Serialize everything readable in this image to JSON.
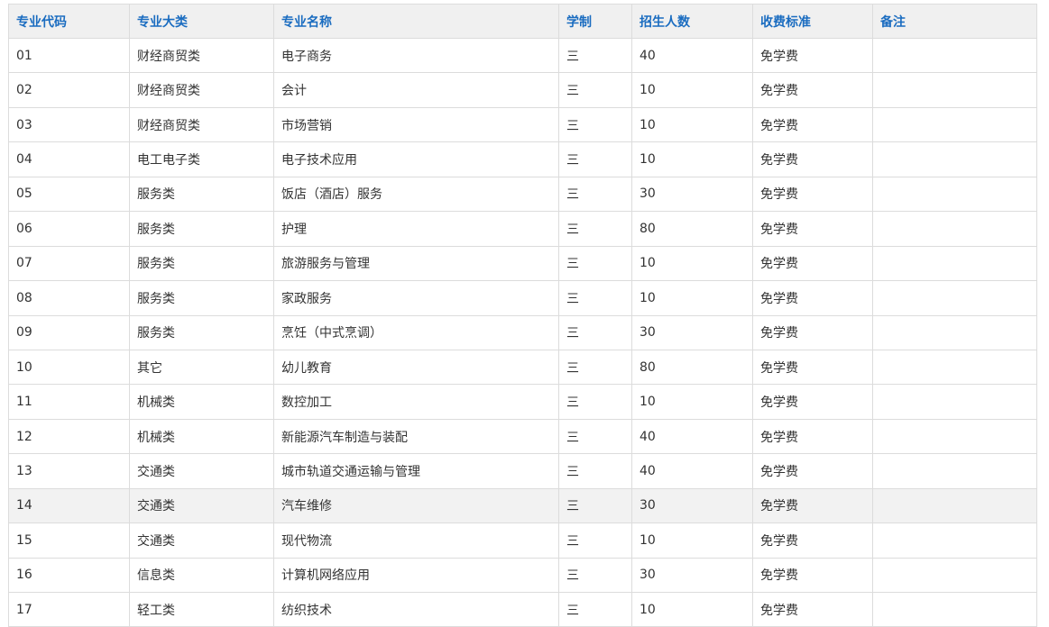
{
  "table": {
    "headers": [
      "专业代码",
      "专业大类",
      "专业名称",
      "学制",
      "招生人数",
      "收费标准",
      "备注"
    ],
    "rows": [
      [
        "01",
        "财经商贸类",
        "电子商务",
        "三",
        "40",
        "免学费",
        ""
      ],
      [
        "02",
        "财经商贸类",
        "会计",
        "三",
        "10",
        "免学费",
        ""
      ],
      [
        "03",
        "财经商贸类",
        "市场营销",
        "三",
        "10",
        "免学费",
        ""
      ],
      [
        "04",
        "电工电子类",
        "电子技术应用",
        "三",
        "10",
        "免学费",
        ""
      ],
      [
        "05",
        "服务类",
        "饭店（酒店）服务",
        "三",
        "30",
        "免学费",
        ""
      ],
      [
        "06",
        "服务类",
        "护理",
        "三",
        "80",
        "免学费",
        ""
      ],
      [
        "07",
        "服务类",
        "旅游服务与管理",
        "三",
        "10",
        "免学费",
        ""
      ],
      [
        "08",
        "服务类",
        "家政服务",
        "三",
        "10",
        "免学费",
        ""
      ],
      [
        "09",
        "服务类",
        "烹饪（中式烹调）",
        "三",
        "30",
        "免学费",
        ""
      ],
      [
        "10",
        "其它",
        "幼儿教育",
        "三",
        "80",
        "免学费",
        ""
      ],
      [
        "11",
        "机械类",
        "数控加工",
        "三",
        "10",
        "免学费",
        ""
      ],
      [
        "12",
        "机械类",
        "新能源汽车制造与装配",
        "三",
        "40",
        "免学费",
        ""
      ],
      [
        "13",
        "交通类",
        "城市轨道交通运输与管理",
        "三",
        "40",
        "免学费",
        ""
      ],
      [
        "14",
        "交通类",
        "汽车维修",
        "三",
        "30",
        "免学费",
        ""
      ],
      [
        "15",
        "交通类",
        "现代物流",
        "三",
        "10",
        "免学费",
        ""
      ],
      [
        "16",
        "信息类",
        "计算机网络应用",
        "三",
        "30",
        "免学费",
        ""
      ],
      [
        "17",
        "轻工类",
        "纺织技术",
        "三",
        "10",
        "免学费",
        ""
      ]
    ],
    "highlighted_row_index": 13
  },
  "colors": {
    "header_text": "#1a6cc0",
    "header_bg": "#f0f0f0",
    "cell_text": "#333333",
    "border": "#dcdcdc",
    "highlight_bg": "#f2f2f2"
  }
}
